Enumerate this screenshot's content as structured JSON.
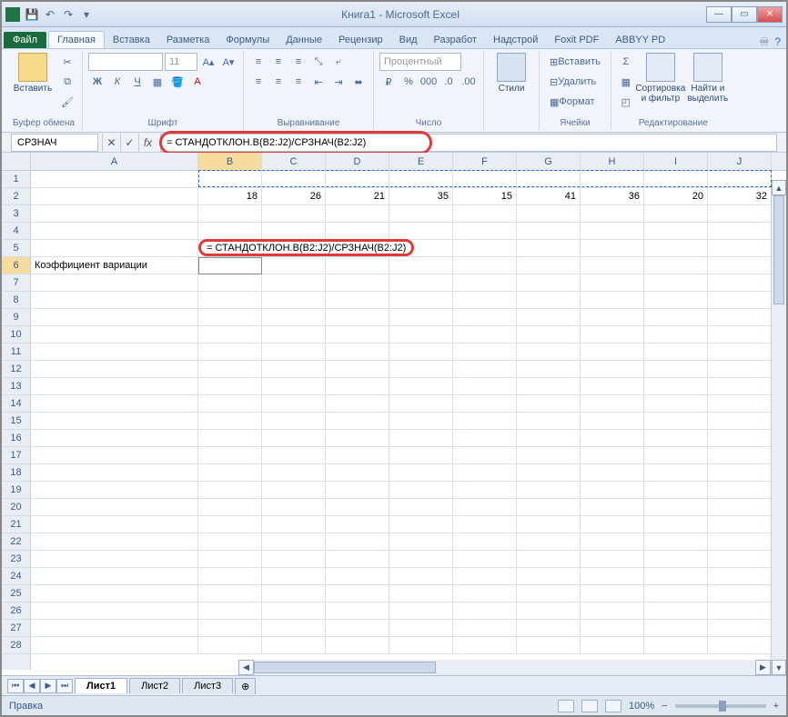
{
  "window": {
    "title": "Книга1 - Microsoft Excel"
  },
  "qat": {
    "save": "💾",
    "undo": "↶",
    "redo": "↷",
    "dd": "▾"
  },
  "tabs": {
    "file": "Файл",
    "home": "Главная",
    "insert": "Вставка",
    "layout": "Разметка",
    "formulas": "Формулы",
    "data": "Данные",
    "review": "Рецензир",
    "view": "Вид",
    "developer": "Разработ",
    "addins": "Надстрой",
    "foxit": "Foxit PDF",
    "abbyy": "ABBYY PD"
  },
  "ribbon": {
    "clipboard": {
      "paste": "Вставить",
      "label": "Буфер обмена"
    },
    "font": {
      "name": "",
      "size": "11",
      "label": "Шрифт"
    },
    "align": {
      "label": "Выравнивание"
    },
    "number": {
      "format": "Процентный",
      "label": "Число"
    },
    "styles": {
      "btn": "Стили",
      "label": ""
    },
    "cells": {
      "insert": "Вставить",
      "delete": "Удалить",
      "format": "Формат",
      "label": "Ячейки"
    },
    "editing": {
      "sort": "Сортировка и фильтр",
      "find": "Найти и выделить",
      "label": "Редактирование"
    }
  },
  "fx": {
    "namebox": "СРЗНАЧ",
    "formula": "= СТАНДОТКЛОН.В(B2:J2)/СРЗНАЧ(B2:J2)"
  },
  "columns": [
    "A",
    "B",
    "C",
    "D",
    "E",
    "F",
    "G",
    "H",
    "I",
    "J"
  ],
  "rows_visible": 28,
  "data_row2": [
    "18",
    "26",
    "21",
    "35",
    "15",
    "41",
    "36",
    "20",
    "32"
  ],
  "a6_label": "Коэффициент вариации",
  "b6_formula": "= СТАНДОТКЛОН.В(B2:J2)/СРЗНАЧ(B2:J2)",
  "sheets": {
    "s1": "Лист1",
    "s2": "Лист2",
    "s3": "Лист3"
  },
  "status": {
    "mode": "Правка",
    "zoom": "100%"
  }
}
